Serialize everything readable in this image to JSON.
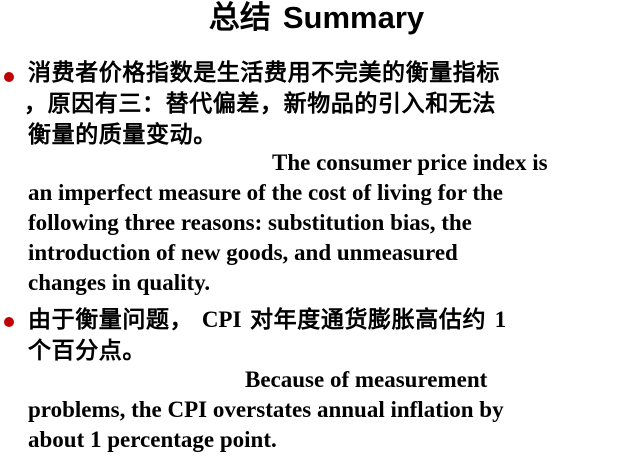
{
  "title": {
    "zh": "总结",
    "en": "Summary"
  },
  "points": [
    {
      "zh_lines": [
        "消费者价格指数是生活费用不完美的衡量指标",
        "，原因有三：替代偏差，新物品的引入和无法",
        "衡量的质量变动。"
      ],
      "en_lines": [
        "The consumer price index is",
        "an imperfect measure of the cost of living for the",
        "following three reasons:  substitution bias, the",
        "introduction of new goods, and unmeasured",
        "changes in quality."
      ]
    },
    {
      "zh_line1_a": "由于衡量问题，",
      "zh_line1_b": "CPI",
      "zh_line1_c": "对年度通货膨胀高估约",
      "zh_line1_d": "1",
      "zh_line2": "个百分点。",
      "en_lines": [
        "Because of measurement",
        "problems, the CPI overstates annual inflation by",
        "about 1 percentage point."
      ]
    }
  ]
}
